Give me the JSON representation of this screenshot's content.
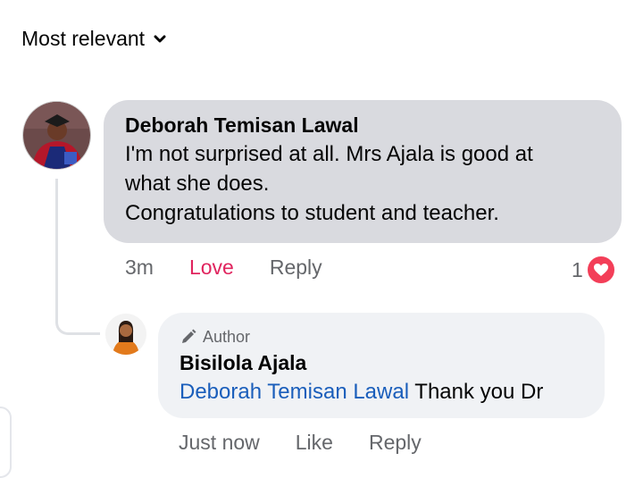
{
  "sort": {
    "label": "Most relevant",
    "icon": "chevron-down-icon"
  },
  "comment": {
    "author": "Deborah Temisan Lawal",
    "lines": [
      "I'm not surprised at all. Mrs Ajala is good at",
      "what she does.",
      "Congratulations to student and teacher."
    ],
    "time": "3m",
    "reaction_label": "Love",
    "reply_label": "Reply",
    "reaction_count": "1",
    "reaction_icon": "heart-icon"
  },
  "reply": {
    "badge": "Author",
    "badge_icon": "pencil-icon",
    "author": "Bisilola Ajala",
    "mention": "Deborah Temisan Lawal",
    "text": "Thank you Dr",
    "time": "Just now",
    "like_label": "Like",
    "reply_label": "Reply"
  },
  "colors": {
    "bubble_main": "#d9dadf",
    "bubble_reply": "#f0f2f5",
    "love": "#e0245e",
    "mention": "#1a5ebb",
    "heart_badge": "#f33e58"
  }
}
